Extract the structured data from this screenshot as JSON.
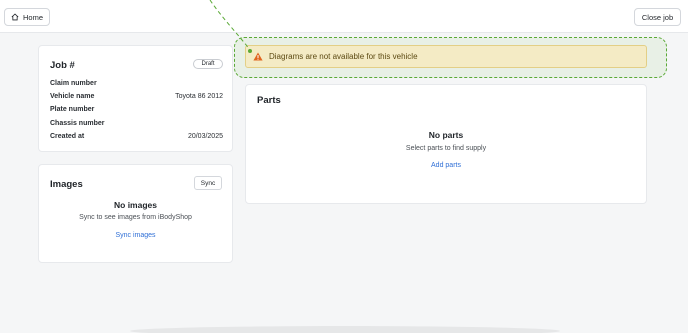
{
  "topbar": {
    "home_label": "Home",
    "close_label": "Close job"
  },
  "job": {
    "title": "Job #",
    "status_badge": "Draft",
    "rows": [
      {
        "label": "Claim number",
        "value": ""
      },
      {
        "label": "Vehicle name",
        "value": "Toyota 86 2012"
      },
      {
        "label": "Plate number",
        "value": ""
      },
      {
        "label": "Chassis number",
        "value": ""
      },
      {
        "label": "Created at",
        "value": "20/03/2025"
      }
    ]
  },
  "images": {
    "title": "Images",
    "sync_label": "Sync",
    "empty_title": "No images",
    "empty_subtitle": "Sync to see images from iBodyShop",
    "action_link": "Sync images"
  },
  "alert": {
    "message": "Diagrams are not available for this vehicle",
    "icon": "warning-triangle-icon",
    "color": "#e0651f"
  },
  "parts": {
    "title": "Parts",
    "empty_title": "No parts",
    "empty_subtitle": "Select parts to find supply",
    "action_link": "Add parts"
  },
  "colors": {
    "link": "#2f6fd6",
    "alert_bg": "#f4ebc5",
    "highlight": "#5aa936"
  }
}
